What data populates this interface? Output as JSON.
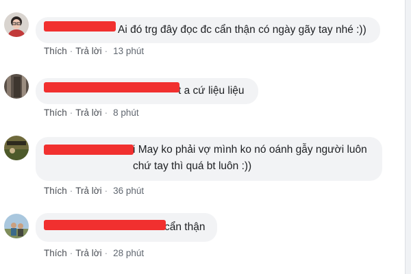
{
  "comments": [
    {
      "text": "Ai đó trg đây đọc đc cẩn thận có ngày gãy tay nhé :))",
      "like_label": "Thích",
      "reply_label": "Trả lời",
      "time": "13 phút",
      "avatar_icon": "user-avatar-woman-glasses"
    },
    {
      "text": "t a cứ liệu liệu",
      "like_label": "Thích",
      "reply_label": "Trả lời",
      "time": "8 phút",
      "avatar_icon": "user-avatar-dark-photo"
    },
    {
      "text": "i May ko phải vợ mình ko nó oánh gẫy người luôn\nchứ tay thì quá bt luôn :))",
      "like_label": "Thích",
      "reply_label": "Trả lời",
      "time": "36 phút",
      "avatar_icon": "user-avatar-outdoor-photo"
    },
    {
      "text": "cẩn thận",
      "like_label": "Thích",
      "reply_label": "Trả lời",
      "time": "28 phút",
      "avatar_icon": "user-avatar-beach-photo"
    }
  ],
  "separator": "·",
  "colors": {
    "bubble": "#f2f3f5",
    "redaction": "#f1302f",
    "action_text": "#606770"
  }
}
